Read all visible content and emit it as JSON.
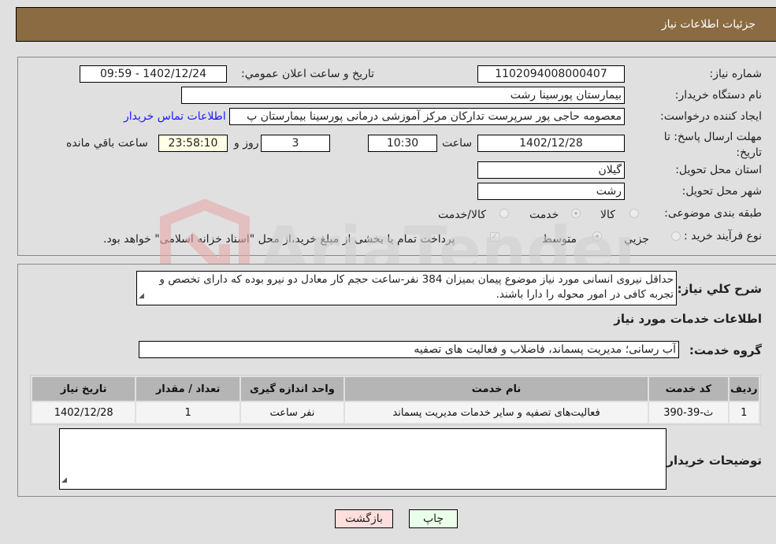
{
  "header": {
    "title": "جزئیات اطلاعات نیاز"
  },
  "fields": {
    "need_number": {
      "label": "شماره نیاز:",
      "value": "1102094008000407"
    },
    "announce_datetime": {
      "label": "تاریخ و ساعت اعلان عمومي:",
      "value": "1402/12/24 - 09:59"
    },
    "buyer_org": {
      "label": "نام دستگاه خريدار:",
      "value": "بیمارستان پورسینا رشت"
    },
    "requester": {
      "label": "ایجاد کننده درخواست:",
      "value": "معصومه حاجی پور سرپرست تدارکان مرکز آموزشی درمانی پورسینا بیمارستان پ"
    },
    "buyer_contact_link": "اطلاعات تماس خریدار",
    "deadline": {
      "label": "مهلت ارسال پاسخ: تا تاریخ:",
      "date": "1402/12/28",
      "time_label": "ساعت",
      "time": "10:30",
      "days": "3",
      "days_label": "روز و",
      "remaining": "23:58:10",
      "remaining_label": "ساعت باقي مانده"
    },
    "province": {
      "label": "استان محل تحویل:",
      "value": "گیلان"
    },
    "city": {
      "label": "شهر محل تحویل:",
      "value": "رشت"
    },
    "category": {
      "label": "طبقه بندی موضوعی:",
      "options": [
        "کالا",
        "خدمت",
        "کالا/خدمت"
      ],
      "selected": "خدمت"
    },
    "purchase_type": {
      "label": "نوع فرآیند خرید :",
      "options": [
        "جزيي",
        "متوسط"
      ],
      "selected": "متوسط",
      "treasury_note": "پرداخت تمام یا بخشی از مبلغ خرید،از محل \"اسناد خزانه اسلامی\" خواهد بود."
    }
  },
  "description": {
    "label": "شرح كلي نياز:",
    "value": "حداقل نیروی انسانی مورد نیاز  موضوع پیمان بمیزان 384  نفر-ساعت حجم کار معادل دو  نیرو بوده که دارای تخصص و تجربه کافی در امور محوله را دارا باشند."
  },
  "services": {
    "section_title": "اطلاعات خدمات مورد نیاز",
    "group_label": "گروه خدمت:",
    "group_value": "آب رسانی؛ مدیریت پسماند، فاضلاب و فعالیت های تصفیه",
    "columns": [
      "رديف",
      "کد خدمت",
      "نام خدمت",
      "واحد اندازه گیری",
      "تعداد / مقدار",
      "تاریخ نیاز"
    ],
    "rows": [
      [
        "1",
        "ث-39-390",
        "فعالیت‌های تصفیه و سایر خدمات مدیریت پسماند",
        "نفر ساعت",
        "1",
        "1402/12/28"
      ]
    ]
  },
  "buyer_notes": {
    "label": "توضیحات خریدار:",
    "value": ""
  },
  "buttons": {
    "print": "چاپ",
    "back": "بازگشت"
  },
  "colors": {
    "header_bg": "#8b6c42",
    "print_bg": "#eaffea",
    "back_bg": "#ffdede",
    "link": "#1a1aff"
  },
  "watermark": "AriaTender.neT"
}
